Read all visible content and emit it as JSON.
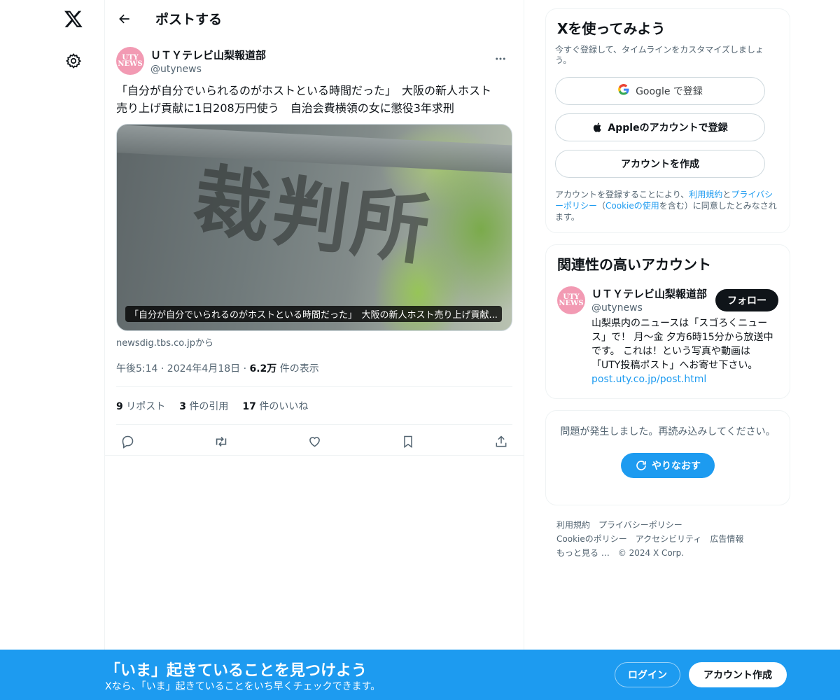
{
  "nav": {
    "logo_icon": "x-logo-icon",
    "settings_icon": "gear-icon"
  },
  "header": {
    "title": "ポストする",
    "back_icon": "arrow-left-icon"
  },
  "post": {
    "author": {
      "name": "ＵＴＹテレビ山梨報道部",
      "handle": "@utynews",
      "avatar_line1": "UTY",
      "avatar_line2": "NEWS"
    },
    "text_line1": "「自分が自分でいられるのがホストといる時間だった」　大阪の新人ホスト",
    "text_line2": "売り上げ貢献に1日208万円使う　自治会費横領の女に懲役3年求刑",
    "media": {
      "kanji": "裁判所",
      "caption": "「自分が自分でいられるのがホストといる時間だった」　大阪の新人ホスト売り上げ貢献..."
    },
    "source": "newsdig.tbs.co.jpから",
    "time": "午後5:14 · 2024年4月18日 · ",
    "views_count": "6.2万",
    "views_label": " 件の表示",
    "stats": {
      "reposts_count": "9",
      "reposts_label": "リポスト",
      "quotes_count": "3",
      "quotes_label": "件の引用",
      "likes_count": "17",
      "likes_label": "件のいいね"
    }
  },
  "signup": {
    "title": "Xを使ってみよう",
    "subtitle": "今すぐ登録して、タイムラインをカスタマイズしましょう。",
    "google_label": "Google で登録",
    "apple_label": "Appleのアカウントで登録",
    "create_label": "アカウントを作成",
    "terms_1": "アカウントを登録することにより、",
    "terms_link1": "利用規約",
    "terms_2": "と",
    "terms_link2": "プライバシーポリシー",
    "terms_3": "（",
    "terms_link3": "Cookieの使用",
    "terms_4": "を含む）に同意したとみなされます。"
  },
  "related": {
    "title": "関連性の高いアカウント",
    "account": {
      "name": "ＵＴＹテレビ山梨報道部",
      "handle": "@utynews",
      "bio": "山梨県内のニュースは「スゴろくニュース」で！ 月〜金 夕方6時15分から放送中です。 これは！という写真や動画は「UTY投稿ポスト」へお寄せ下さい。",
      "link": "post.uty.co.jp/post.html",
      "follow_label": "フォロー"
    }
  },
  "error": {
    "message": "問題が発生しました。再読み込みしてください。",
    "retry_label": "やりなおす"
  },
  "footer": {
    "links": [
      "利用規約",
      "プライバシーポリシー",
      "Cookieのポリシー",
      "アクセシビリティ",
      "広告情報",
      "もっと見る …",
      "© 2024 X Corp."
    ]
  },
  "banner": {
    "title": "「いま」起きていることを見つけよう",
    "subtitle": "Xなら、「いま」起きていることをいち早くチェックできます。",
    "login_label": "ログイン",
    "create_label": "アカウント作成"
  },
  "colors": {
    "accent": "#1d9bf0",
    "text": "#0f1419",
    "secondary": "#536471",
    "avatar_pink": "#f29ab3"
  }
}
